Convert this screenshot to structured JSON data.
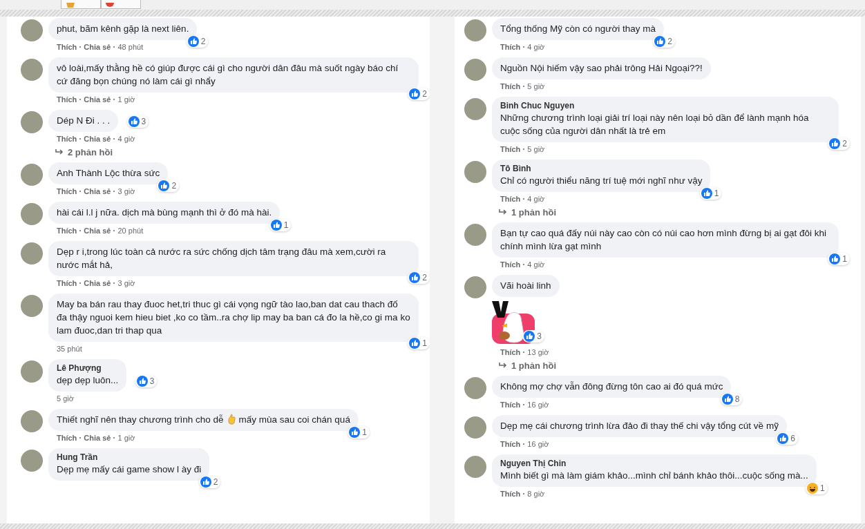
{
  "columns": [
    {
      "comments": [
        {
          "text": "phut, bãm kênh gặp là next liên.",
          "actions": [
            "Thích",
            "Chia sẻ"
          ],
          "time": "48 phút",
          "kind": "like",
          "likes": "2"
        },
        {
          "text": "vô loài,mấy thằng hề có giúp được cái gì cho người dân đâu mà suốt ngày báo chí cứ đăng bọn chúng nó làm cái gì nhẩy",
          "actions": [
            "Thích",
            "Chia sẻ"
          ],
          "time": "1 giờ",
          "kind": "like",
          "likes": "2"
        },
        {
          "text": "Dép N Đi . . .",
          "actions": [
            "Thích",
            "Chia sẻ"
          ],
          "time": "4 giờ",
          "kind": "like",
          "likes": "3",
          "replies": "2 phản hồi"
        },
        {
          "text": "Anh Thành Lộc thừa sức",
          "actions": [
            "Thích",
            "Chia sẻ"
          ],
          "time": "3 giờ",
          "kind": "like",
          "likes": "2"
        },
        {
          "text": "hài cái l.l j nữa. dịch mà bùng mạnh thì ở đó mà hài.",
          "actions": [
            "Thích",
            "Chia sẻ"
          ],
          "time": "20 phút",
          "kind": "like",
          "likes": "1"
        },
        {
          "text": "Dẹp r i,trong lúc toàn cả nước ra sức chống dịch tâm trạng đâu mà xem,cười ra nước mắt hả,",
          "actions": [
            "Thích",
            "Chia sẻ"
          ],
          "time": "3 giờ",
          "kind": "like",
          "likes": "2"
        },
        {
          "text": "May ba bán rau thay đuoc het,tri thuc gì cái vọng ngữ tào lao,ban dat cau thach đố đa thậy nguoi kem hieu biet ,ko co tầm..ra chợ lip may ba ban cá đo la hề,co gi ma ko lam đuoc,dan tri thap qua",
          "time": "35 phút",
          "kind": "like",
          "likes": "1"
        },
        {
          "author": "Lê Phượng",
          "text": "dẹp dẹp luôn...",
          "time": "5 giờ",
          "kind": "like",
          "likes": "3"
        },
        {
          "text": "Thiết nghĩ nên thay chương trình cho dễ",
          "emoji": true,
          "text_after": "mấy mùa sau coi chán quá",
          "actions": [
            "Thích",
            "Chia sẻ"
          ],
          "time": "1 giờ",
          "kind": "like",
          "likes": "1"
        },
        {
          "author": "Hung Trần",
          "text": "Dẹp mẹ mấy cái game show l ày đi",
          "kind": "like",
          "likes": "2"
        }
      ]
    },
    {
      "comments": [
        {
          "text": "Tổng thống Mỹ còn có người thay mà",
          "actions": [
            "Thích"
          ],
          "time": "4 giờ",
          "kind": "like",
          "likes": "2"
        },
        {
          "text": "Nguồn Nội hiếm vậy sao phải trông Hải Ngoại??!",
          "actions": [
            "Thích"
          ],
          "time": "5 giờ"
        },
        {
          "author": "Binh Chuc Nguyen",
          "text": "Những chương trình loại giải trí loại này nên loại bỏ dần để lành mạnh hóa cuộc sống của người dân nhất là trẻ em",
          "actions": [
            "Thích"
          ],
          "time": "5 giờ",
          "kind": "like",
          "likes": "2"
        },
        {
          "author": "Tô Bình",
          "text": "Chỉ có người thiểu năng trí tuệ mới nghĩ như vậy",
          "actions": [
            "Thích"
          ],
          "time": "4 giờ",
          "kind": "like",
          "likes": "1",
          "replies": "1 phản hồi"
        },
        {
          "text": "Bạn tự cao quá đấy núi này cao còn có núi cao hơn mình đừng bị ai gạt đôi khi chính mình lừa gạt mình",
          "actions": [
            "Thích"
          ],
          "time": "4 giờ",
          "kind": "like",
          "likes": "1"
        },
        {
          "text": "Vãi hoài linh",
          "sticker": true,
          "actions": [
            "Thích"
          ],
          "time": "13 giờ",
          "kind": "like",
          "likes": "3",
          "replies": "1 phản hồi"
        },
        {
          "text": "Không mợ chợ vẫn đông đừng tôn cao ai đó quá mức",
          "actions": [
            "Thích"
          ],
          "time": "16 giờ",
          "kind": "like",
          "likes": "8"
        },
        {
          "text": "Dẹp mẹ cái chương trình lừa đảo đi thay thế chi vậy tổng cút về mỹ",
          "actions": [
            "Thích"
          ],
          "time": "16 giờ",
          "kind": "like",
          "likes": "6"
        },
        {
          "author": "Nguyen Thị Chin",
          "text": "Mình biết gì mà làm giám khảo...mình chỉ bánh khảo thôi...cuộc sống mà...",
          "actions": [
            "Thích"
          ],
          "time": "8 giờ",
          "kind": "haha",
          "likes": "1"
        }
      ]
    }
  ]
}
